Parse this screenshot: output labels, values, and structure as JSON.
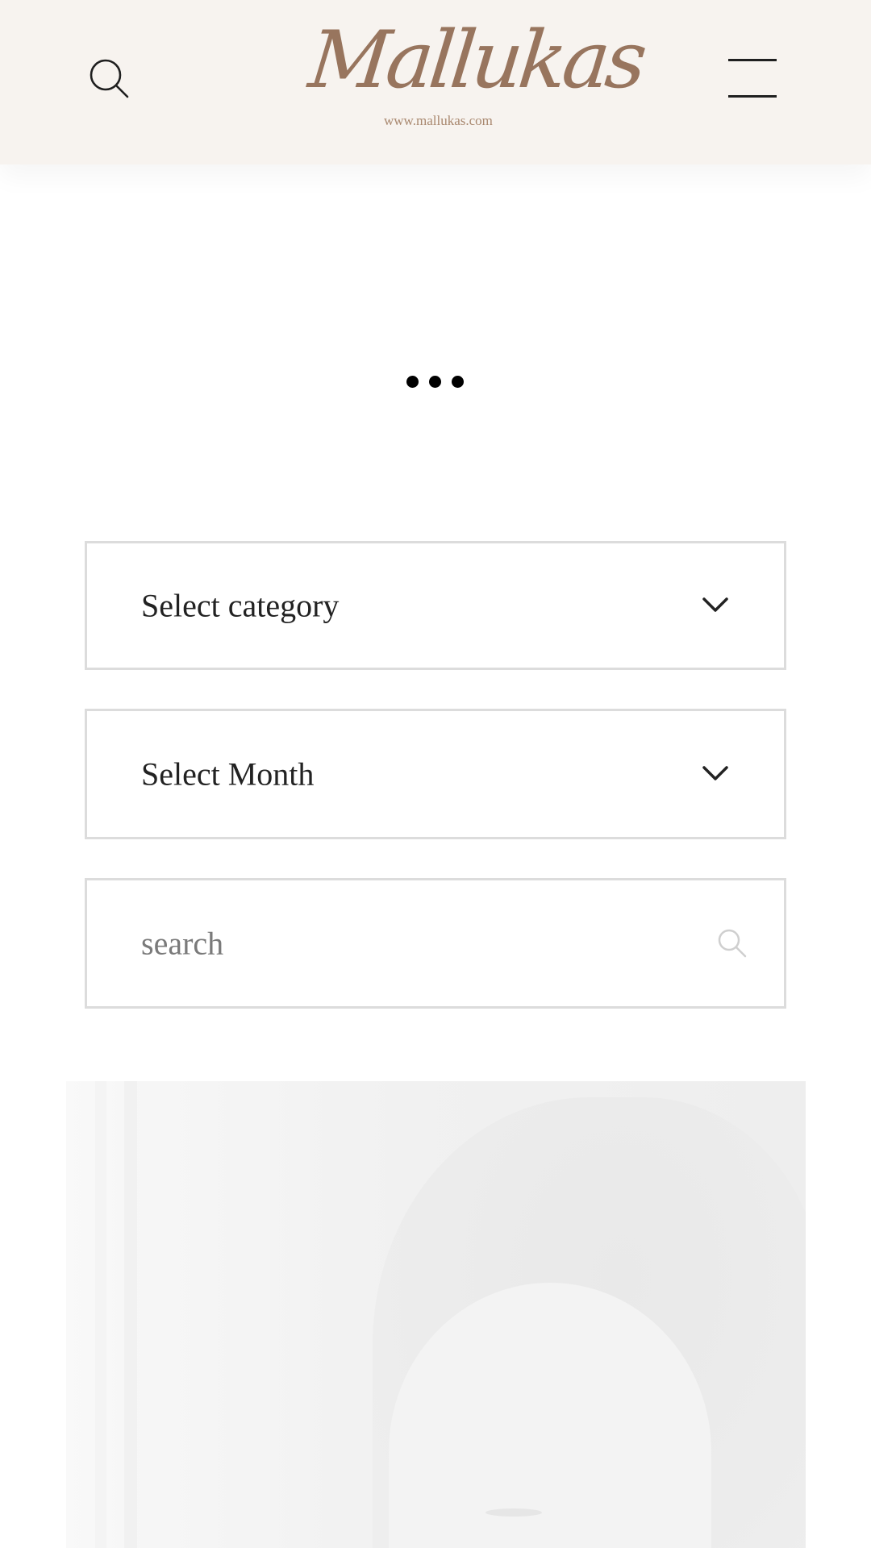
{
  "header": {
    "logo_text": "Mallukas",
    "logo_url": "www.mallukas.com"
  },
  "filters": {
    "category": {
      "selected": "Select category"
    },
    "month": {
      "selected": "Select Month"
    }
  },
  "search": {
    "placeholder": "search"
  },
  "colors": {
    "header_background": "#f7f3ef",
    "logo_brown": "#98755e",
    "field_border": "#dcdcdc"
  }
}
